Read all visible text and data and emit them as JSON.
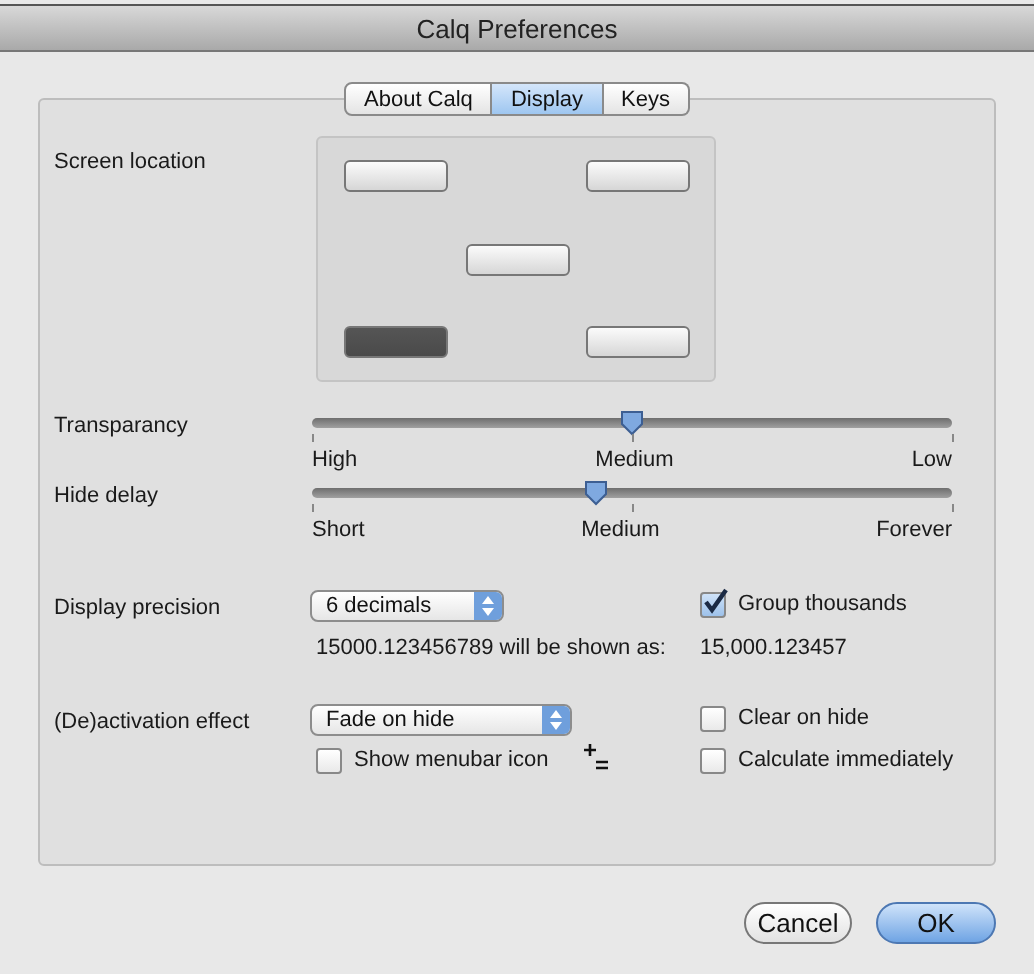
{
  "window": {
    "title": "Calq Preferences"
  },
  "tabs": [
    {
      "label": "About Calq",
      "selected": false
    },
    {
      "label": "Display",
      "selected": true
    },
    {
      "label": "Keys",
      "selected": false
    }
  ],
  "screen_location": {
    "label": "Screen location",
    "positions": [
      {
        "kind": "top-left",
        "selected": false
      },
      {
        "kind": "top-right",
        "selected": false
      },
      {
        "kind": "center",
        "selected": false
      },
      {
        "kind": "bottom-left",
        "selected": true
      },
      {
        "kind": "bottom-right",
        "selected": false
      }
    ]
  },
  "sliders": [
    {
      "label": "Transparancy",
      "level": 0.5,
      "ticks": [
        "High",
        "Medium",
        "Low"
      ]
    },
    {
      "label": "Hide delay",
      "level": 0.445,
      "ticks": [
        "Short",
        "Medium",
        "Forever"
      ]
    }
  ],
  "precision": {
    "label": "Display precision",
    "popup": "6 decimals",
    "example_label": "15000.123456789 will be shown as:",
    "example_value": "15,000.123457"
  },
  "group_thousands": {
    "label": "Group thousands",
    "checked": true
  },
  "effect": {
    "label": "(De)activation effect",
    "popup": "Fade on hide"
  },
  "show_menubar_icon": {
    "label": "Show menubar icon",
    "checked": false
  },
  "clear_on_hide": {
    "label": "Clear on hide",
    "checked": false
  },
  "calculate_immediately": {
    "label": "Calculate immediately",
    "checked": false
  },
  "buttons": [
    {
      "label": "Cancel",
      "kind": "cancel"
    },
    {
      "label": "OK",
      "kind": "default"
    }
  ]
}
